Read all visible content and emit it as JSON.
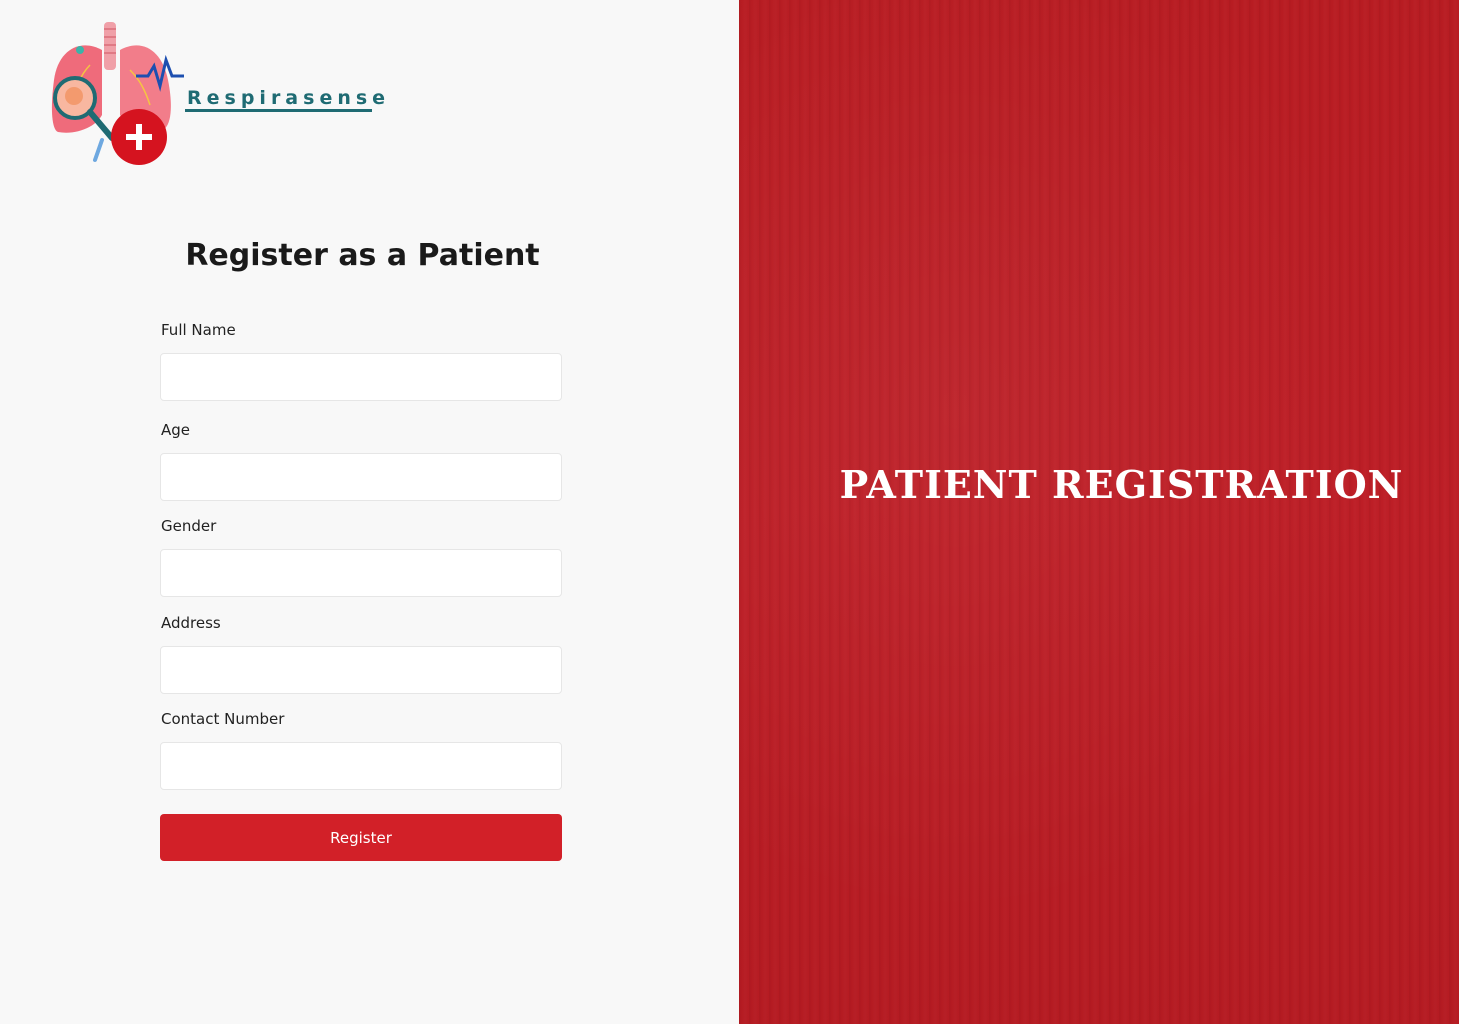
{
  "brand": {
    "name": "Respirasense"
  },
  "form": {
    "heading": "Register as a Patient",
    "fields": [
      {
        "label": "Full Name",
        "value": "",
        "placeholder": ""
      },
      {
        "label": "Age",
        "value": "",
        "placeholder": ""
      },
      {
        "label": "Gender",
        "value": "",
        "placeholder": ""
      },
      {
        "label": "Address",
        "value": "",
        "placeholder": ""
      },
      {
        "label": "Contact Number",
        "value": "",
        "placeholder": ""
      }
    ],
    "submit_label": "Register"
  },
  "banner": {
    "title": "PATIENT REGISTRATION"
  },
  "colors": {
    "accent": "#d22028",
    "banner_bg": "#b91d24",
    "brand": "#1f6b73",
    "page_bg": "#f8f8f8"
  },
  "icons": [
    "lungs-logo-icon",
    "medical-plus-icon",
    "magnifier-icon",
    "heartbeat-line-icon"
  ]
}
